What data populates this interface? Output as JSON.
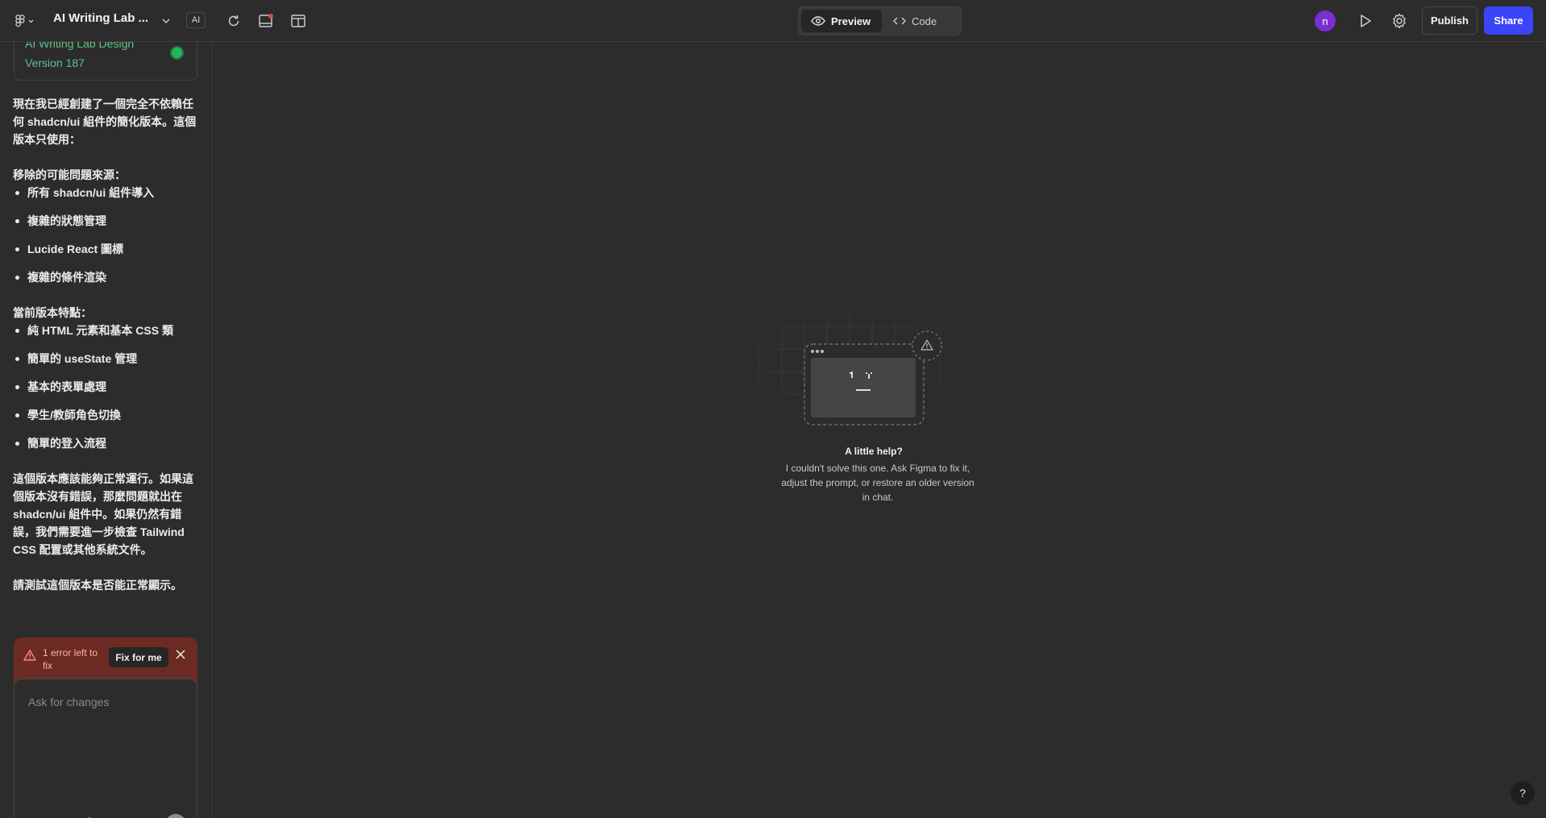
{
  "topbar": {
    "project_title": "AI Writing Lab ...",
    "ai_badge": "AI",
    "tabs": [
      {
        "label": "Preview",
        "icon": "eye-icon",
        "active": true
      },
      {
        "label": "Code",
        "icon": "code-icon",
        "active": false
      }
    ],
    "avatar_initial": "n",
    "publish_label": "Publish",
    "share_label": "Share"
  },
  "sidebar": {
    "version": {
      "name": "AI Writing Lab Design",
      "label": "Version 187",
      "status_color": "#1db954"
    },
    "message": {
      "intro": "現在我已經創建了一個完全不依賴任何 shadcn/ui 組件的簡化版本。這個版本只使用：",
      "removed_heading": "移除的可能問題來源：",
      "removed_items": [
        "所有 shadcn/ui 組件導入",
        "複雜的狀態管理",
        "Lucide React 圖標",
        "複雜的條件渲染"
      ],
      "features_heading": "當前版本特點：",
      "features_items": [
        "純 HTML 元素和基本 CSS 類",
        "簡單的 useState 管理",
        "基本的表單處理",
        "學生/教師角色切換",
        "簡單的登入流程"
      ],
      "conclusion": "這個版本應該能夠正常運行。如果這個版本沒有錯誤，那麼問題就出在 shadcn/ui 組件中。如果仍然有錯誤，我們需要進一步檢查 Tailwind CSS 配置或其他系統文件。",
      "closing": "請測試這個版本是否能正常顯示。"
    },
    "error_bar": {
      "text": "1 error left to fix",
      "fix_label": "Fix for me"
    },
    "composer": {
      "placeholder": "Ask for changes",
      "value": ""
    }
  },
  "canvas": {
    "help_title": "A little help?",
    "help_body": "I couldn't solve this one. Ask Figma to fix it, adjust the prompt, or restore an older version in chat.",
    "help_button": "?"
  },
  "colors": {
    "accent": "#3b44f6",
    "error_bg": "#6b2b23",
    "version_text": "#5ec28a",
    "avatar": "#7b2fd0"
  }
}
